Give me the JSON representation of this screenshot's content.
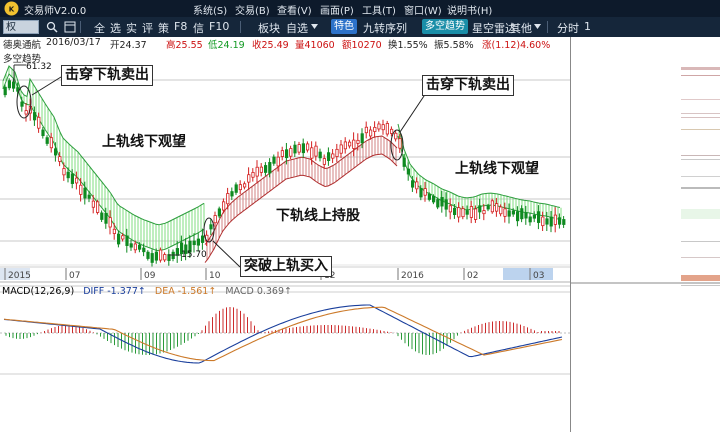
{
  "window": {
    "app_title": "交易师V2.0.0",
    "menus": [
      "系统(S)",
      "交易(B)",
      "查看(V)",
      "画面(P)",
      "工具(T)",
      "窗口(W)",
      "说明书(H)"
    ]
  },
  "toolbar": {
    "period_combo": "权",
    "items": [
      "全",
      "选",
      "实",
      "评",
      "策",
      "F8",
      "信",
      "F10",
      "板块",
      "自选",
      "九转序列",
      "星空雷达",
      "其他",
      "分时",
      "1"
    ],
    "badges": [
      "特色",
      "多空趋势"
    ]
  },
  "quote": {
    "name": "德奥通航",
    "date": "2016/03/17",
    "open": "开24.37",
    "high": "高25.55",
    "low": "低24.19",
    "close": "收25.49",
    "volume": "量41060",
    "amount": "额10270",
    "turnover": "换1.55%",
    "amplitude": "振5.58%",
    "change": "涨(1.12)4.60%",
    "indicator_name": "多空趋势"
  },
  "chart_data": {
    "type": "candlestick",
    "axis_labels": [
      "2015",
      "07",
      "09",
      "10",
      "12",
      "2016",
      "02",
      "03"
    ],
    "annotations": {
      "high_label": "61.32",
      "low_label": "15.70",
      "sell_1": "击穿下轨卖出",
      "sell_2": "击穿下轨卖出",
      "watch_1": "上轨线下观望",
      "watch_2": "上轨线下观望",
      "hold": "下轨线上持股",
      "buy": "突破上轨买入"
    },
    "colors": {
      "up": "#d42020",
      "down": "#0e8a20",
      "band_down": "#7fdc7f",
      "band_up": "#d28080"
    },
    "macd": {
      "label": "MACD(12,26,9)",
      "diff": "DIFF -1.377↑",
      "dea": "DEA -1.561↑",
      "macd": "MACD 0.369↑",
      "colors": {
        "diff": "#1a3f9c",
        "dea": "#cc7a2a",
        "macd": "#666666"
      }
    }
  }
}
